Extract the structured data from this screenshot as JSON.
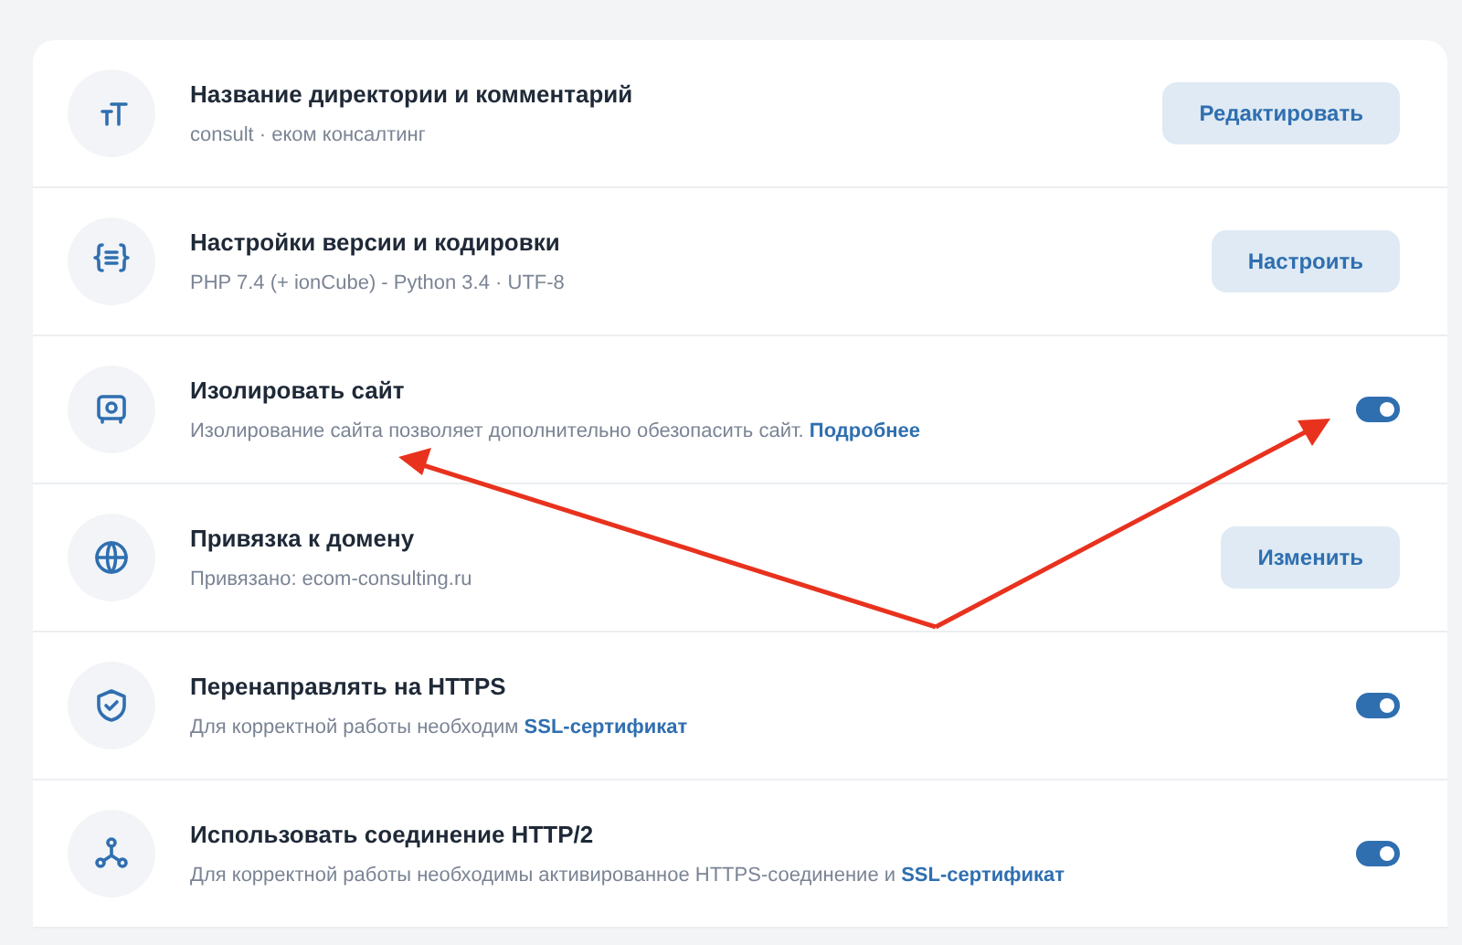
{
  "settings": [
    {
      "title": "Название директории и комментарий",
      "subtitle": "consult · еком консалтинг",
      "kind": "button",
      "button": "Редактировать"
    },
    {
      "title": "Настройки версии и кодировки",
      "subtitle": "PHP 7.4 (+ ionCube) - Python 3.4 · UTF-8",
      "kind": "button",
      "button": "Настроить"
    },
    {
      "title": "Изолировать сайт",
      "subtitle": "Изолирование сайта позволяет дополнительно обезопасить сайт.",
      "link": "Подробнее",
      "kind": "toggle",
      "on": true
    },
    {
      "title": "Привязка к домену",
      "subtitle": "Привязано: ecom-consulting.ru",
      "kind": "button",
      "button": "Изменить"
    },
    {
      "title": "Перенаправлять на HTTPS",
      "subtitle": "Для корректной работы необходим",
      "link": "SSL-сертификат",
      "kind": "toggle",
      "on": true
    },
    {
      "title": "Использовать соединение HTTP/2",
      "subtitle": "Для корректной работы необходимы активированное HTTPS-соединение и",
      "link": "SSL-сертификат",
      "kind": "toggle",
      "on": true
    }
  ]
}
